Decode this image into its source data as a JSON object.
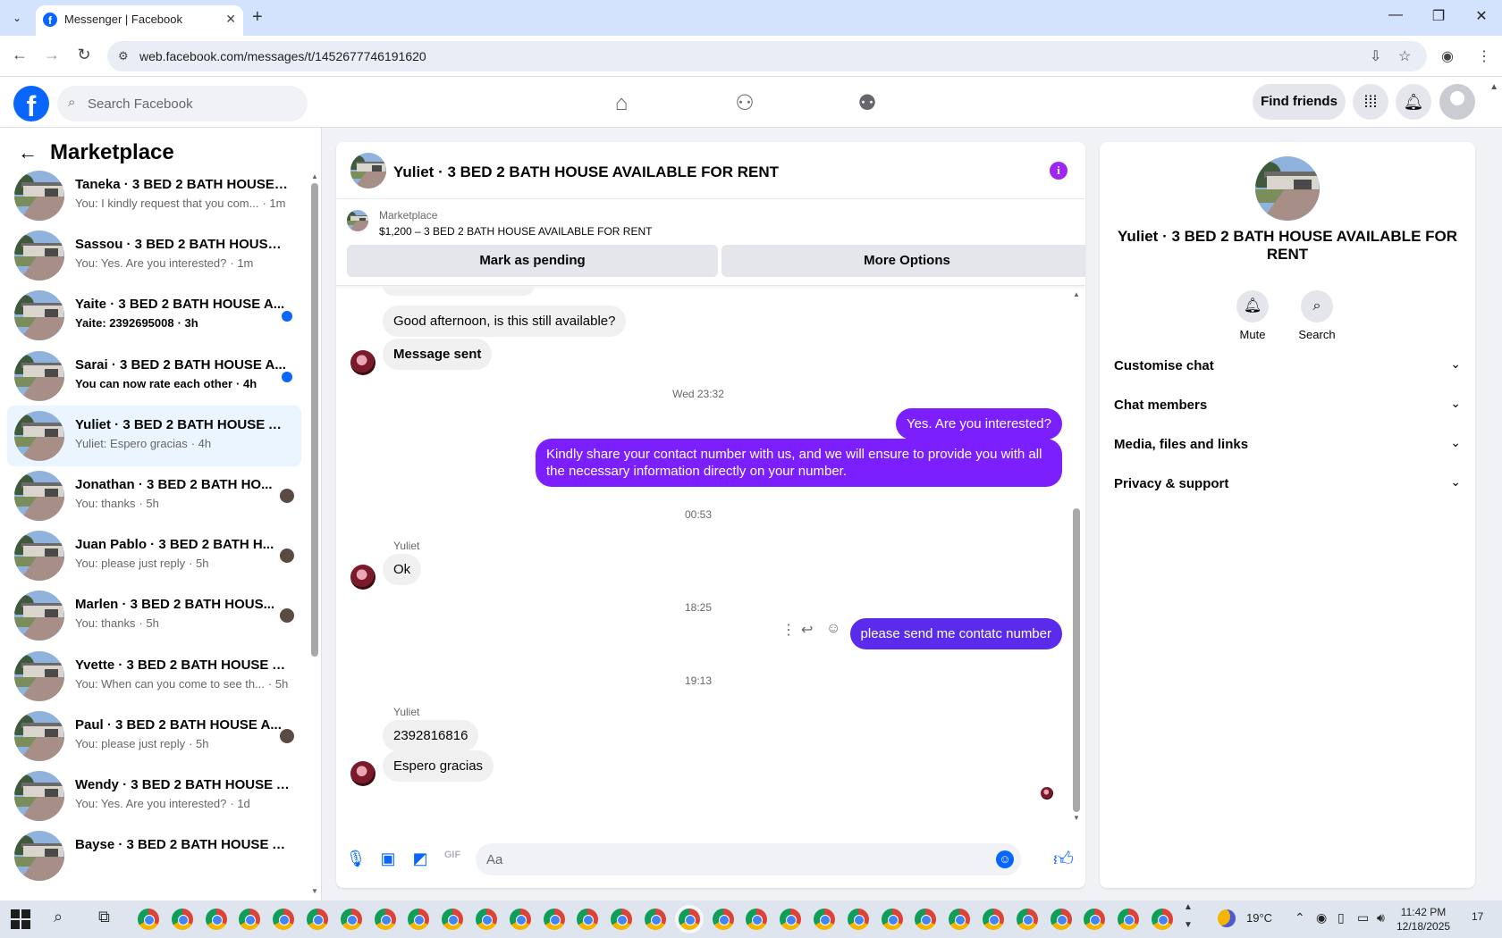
{
  "browser": {
    "tab_title": "Messenger | Facebook",
    "url": "web.facebook.com/messages/t/1452677746191620"
  },
  "fb_header": {
    "search_placeholder": "Search Facebook",
    "find_friends": "Find friends"
  },
  "sidebar": {
    "title": "Marketplace",
    "conversations": [
      {
        "name": "Taneka · 3 BED 2 BATH HOUSE A...",
        "preview": "You: I kindly request that you com...",
        "time": "· 1m",
        "unread": false,
        "state": "none"
      },
      {
        "name": "Sassou · 3 BED 2 BATH HOUSE A...",
        "preview": "You: Yes. Are you interested?",
        "time": "· 1m",
        "unread": false,
        "state": "none"
      },
      {
        "name": "Yaite · 3 BED 2 BATH HOUSE A...",
        "preview": "Yaite: 2392695008",
        "time": "· 3h",
        "unread": true,
        "state": "dot"
      },
      {
        "name": "Sarai · 3 BED 2 BATH HOUSE A...",
        "preview": "You can now rate each other",
        "time": "· 4h",
        "unread": true,
        "state": "dot"
      },
      {
        "name": "Yuliet · 3 BED 2 BATH HOUSE AV...",
        "preview": "Yuliet: Espero gracias",
        "time": "· 4h",
        "unread": false,
        "state": "active"
      },
      {
        "name": "Jonathan · 3 BED 2 BATH HO...",
        "preview": "You: thanks",
        "time": "· 5h",
        "unread": false,
        "state": "seen"
      },
      {
        "name": "Juan Pablo · 3 BED 2 BATH H...",
        "preview": "You: please just reply",
        "time": "· 5h",
        "unread": false,
        "state": "seen"
      },
      {
        "name": "Marlen · 3 BED 2 BATH HOUS...",
        "preview": "You: thanks",
        "time": "· 5h",
        "unread": false,
        "state": "seen"
      },
      {
        "name": "Yvette · 3 BED 2 BATH HOUSE A...",
        "preview": "You: When can you come to see th...",
        "time": "· 5h",
        "unread": false,
        "state": "none"
      },
      {
        "name": "Paul · 3 BED 2 BATH HOUSE A...",
        "preview": "You: please just reply",
        "time": "· 5h",
        "unread": false,
        "state": "seen"
      },
      {
        "name": "Wendy · 3 BED 2 BATH HOUSE A...",
        "preview": "You: Yes. Are you interested?",
        "time": "· 1d",
        "unread": false,
        "state": "none"
      },
      {
        "name": "Bayse · 3 BED 2 BATH HOUSE AV...",
        "preview": "",
        "time": "",
        "unread": false,
        "state": "none"
      }
    ]
  },
  "chat": {
    "title": "Yuliet · 3 BED 2 BATH HOUSE AVAILABLE FOR RENT",
    "listing_label": "Marketplace",
    "listing_price": "$1,200 – 3 BED 2 BATH HOUSE AVAILABLE FOR RENT",
    "mark_pending": "Mark as pending",
    "more_options": "More Options",
    "messages": {
      "m1": "Good afternoon, is this still available?",
      "m2": "Message sent",
      "t1": "Wed 23:32",
      "m3": "Yes. Are you interested?",
      "m4": "Kindly share your contact number with us, and we will ensure to provide you with all the necessary information directly on your number.",
      "t2": "00:53",
      "sender1": "Yuliet",
      "m5": "Ok",
      "t3": "18:25",
      "m6": "please send me contatc number",
      "t4": "19:13",
      "sender2": "Yuliet",
      "m7": "2392816816",
      "m8": "Espero gracias"
    },
    "composer_placeholder": "Aa"
  },
  "info": {
    "name": "Yuliet · 3 BED 2 BATH HOUSE AVAILABLE FOR RENT",
    "mute": "Mute",
    "search": "Search",
    "sections": [
      "Customise chat",
      "Chat members",
      "Media, files and links",
      "Privacy & support"
    ]
  },
  "taskbar": {
    "temperature": "19°C",
    "time": "11:42 PM",
    "date": "12/18/2025",
    "notifications": "17"
  },
  "colors": {
    "fb_blue": "#0866ff",
    "outgoing_bubble": "#7b1fff",
    "active_conv_bg": "#ebf5ff"
  }
}
